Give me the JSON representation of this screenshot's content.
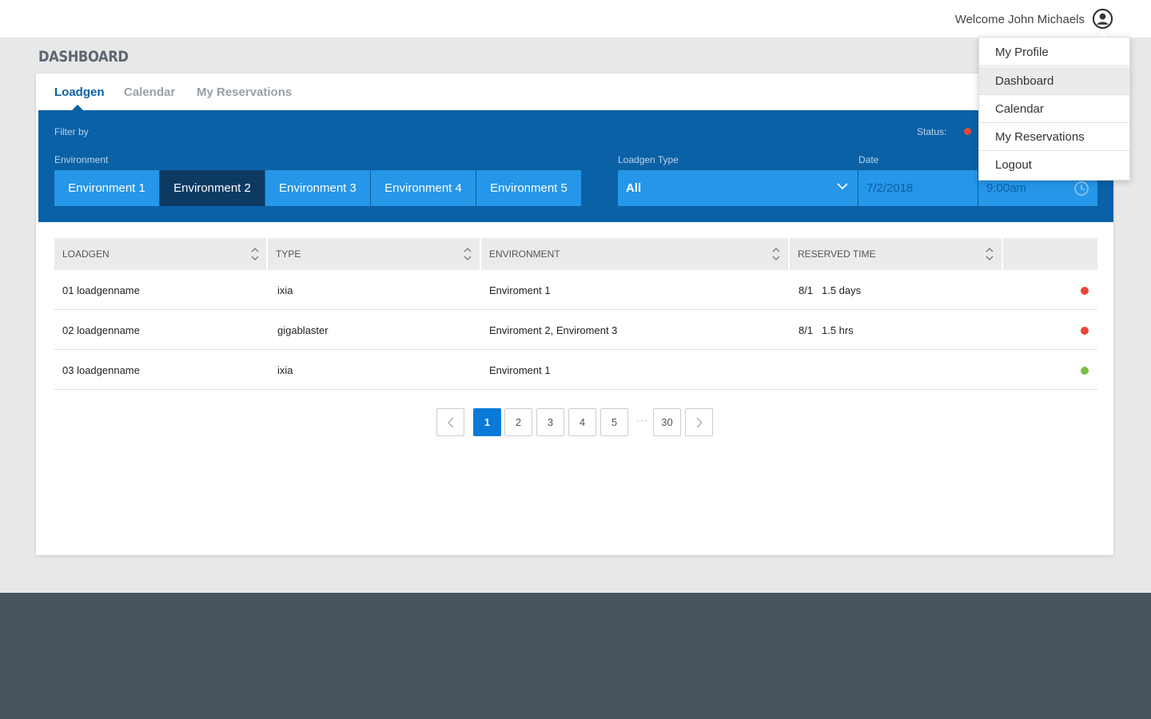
{
  "header": {
    "welcome": "Welcome John Michaels",
    "user_icon": "user-circle-icon"
  },
  "page": {
    "title": "DASHBOARD"
  },
  "tabs": [
    {
      "label": "Loadgen",
      "active": true
    },
    {
      "label": "Calendar",
      "active": false
    },
    {
      "label": "My Reservations",
      "active": false
    }
  ],
  "filters": {
    "filter_by": "Filter by",
    "status_label": "Status:",
    "environment_label": "Environment",
    "environments": [
      {
        "label": "Environment 1",
        "active": false
      },
      {
        "label": "Environment 2",
        "active": true
      },
      {
        "label": "Environment 3",
        "active": false
      },
      {
        "label": "Environment 4",
        "active": false
      },
      {
        "label": "Environment 5",
        "active": false
      }
    ],
    "loadgen_type_label": "Loadgen Type",
    "loadgen_type_value": "All",
    "date_label": "Date",
    "date_value": "7/2/2018",
    "time_value": "9:00am"
  },
  "table": {
    "columns": [
      "LOADGEN",
      "TYPE",
      "ENVIRONMENT",
      "RESERVED TIME"
    ],
    "rows": [
      {
        "loadgen": "01 loadgenname",
        "type": "ixia",
        "environment": "Enviroment 1",
        "reserved_date": "8/1",
        "reserved_duration": "1.5 days",
        "status": "reserved"
      },
      {
        "loadgen": "02 loadgenname",
        "type": "gigablaster",
        "environment": "Enviroment 2, Enviroment 3",
        "reserved_date": "8/1",
        "reserved_duration": "1.5 hrs",
        "status": "reserved"
      },
      {
        "loadgen": "03 loadgenname",
        "type": "ixia",
        "environment": "Enviroment 1",
        "reserved_date": "",
        "reserved_duration": "",
        "status": "available"
      }
    ]
  },
  "pagination": {
    "pages": [
      "1",
      "2",
      "3",
      "4",
      "5"
    ],
    "current": "1",
    "ellipsis": "···",
    "last": "30"
  },
  "user_menu": {
    "items": [
      {
        "label": "My Profile",
        "highlighted": false
      },
      {
        "label": "Dashboard",
        "highlighted": true
      },
      {
        "label": "Calendar",
        "highlighted": false
      },
      {
        "label": "My Reservations",
        "highlighted": false
      },
      {
        "label": "Logout",
        "highlighted": false
      }
    ]
  },
  "colors": {
    "primary": "#0a61a6",
    "accent": "#2596e8",
    "active_env": "#0d3a63",
    "status_reserved": "#e8463b",
    "status_available": "#7ac142",
    "footer": "#48555e"
  }
}
